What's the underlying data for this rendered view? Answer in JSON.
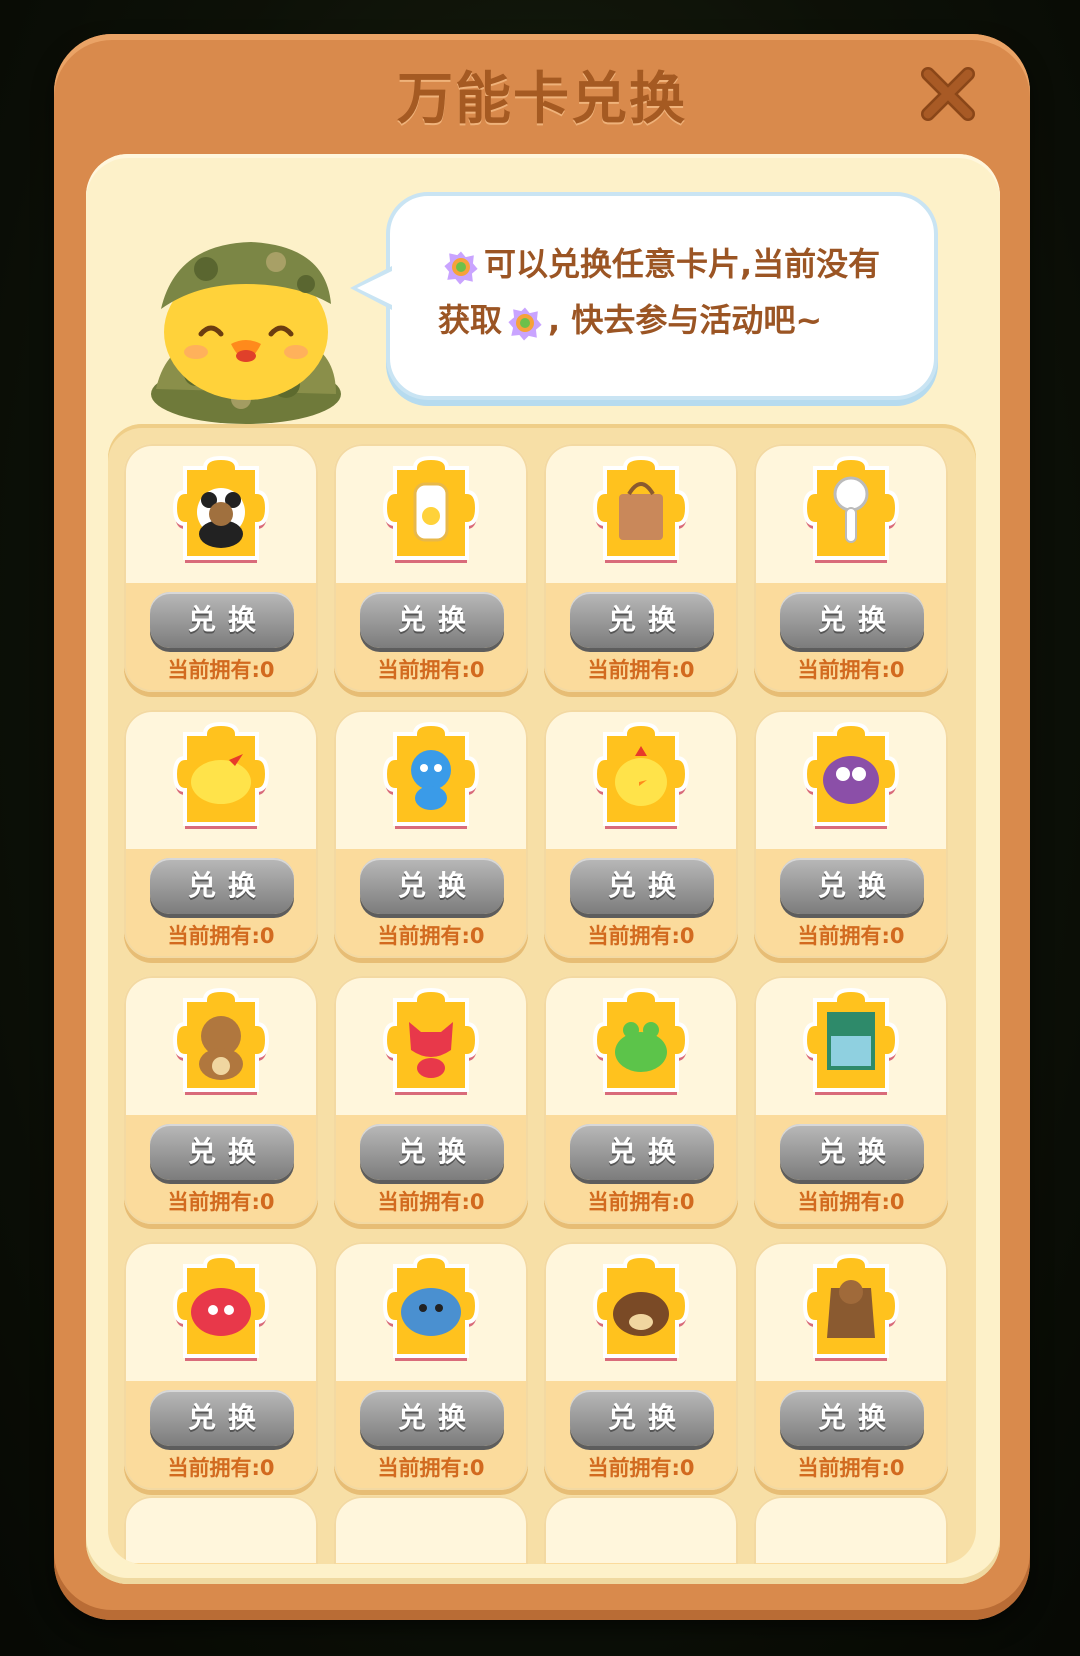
{
  "dialog": {
    "title": "万能卡兑换",
    "close_icon": "close-x-icon"
  },
  "speech": {
    "line1": "可以兑换任意卡片,当前没有",
    "line2_a": "获取",
    "line2_b": ", 快去参与活动吧~",
    "icon": "wildcard-icon"
  },
  "colors": {
    "frame": "#d98a4c",
    "panel": "#fdf1c9",
    "puzzle": "#ffc21e",
    "button_disabled": "#8f8f8f",
    "owned_text": "#d26a1f"
  },
  "cards": [
    {
      "icon": "panda-plush-icon",
      "button": "兑换",
      "owned": "当前拥有:0"
    },
    {
      "icon": "water-bottle-icon",
      "button": "兑换",
      "owned": "当前拥有:0"
    },
    {
      "icon": "tote-bag-icon",
      "button": "兑换",
      "owned": "当前拥有:0"
    },
    {
      "icon": "handheld-fan-icon",
      "button": "兑换",
      "owned": "当前拥有:0"
    },
    {
      "icon": "yellow-chick-plush-icon",
      "button": "兑换",
      "owned": "当前拥有:0"
    },
    {
      "icon": "blue-bear-plush-icon",
      "button": "兑换",
      "owned": "当前拥有:0"
    },
    {
      "icon": "chick-plush-icon",
      "button": "兑换",
      "owned": "当前拥有:0"
    },
    {
      "icon": "purple-owl-plush-icon",
      "button": "兑换",
      "owned": "当前拥有:0"
    },
    {
      "icon": "brown-bear-plush-icon",
      "button": "兑换",
      "owned": "当前拥有:0"
    },
    {
      "icon": "red-fox-plush-icon",
      "button": "兑换",
      "owned": "当前拥有:0"
    },
    {
      "icon": "green-frog-plush-icon",
      "button": "兑换",
      "owned": "当前拥有:0"
    },
    {
      "icon": "puzzle-box-icon",
      "button": "兑换",
      "owned": "当前拥有:0"
    },
    {
      "icon": "fox-pillow-icon",
      "button": "兑换",
      "owned": "当前拥有:0"
    },
    {
      "icon": "blue-creature-pillow-icon",
      "button": "兑换",
      "owned": "当前拥有:0"
    },
    {
      "icon": "bear-slippers-icon",
      "button": "兑换",
      "owned": "当前拥有:0"
    },
    {
      "icon": "raccoon-blanket-icon",
      "button": "兑换",
      "owned": "当前拥有:0"
    }
  ]
}
